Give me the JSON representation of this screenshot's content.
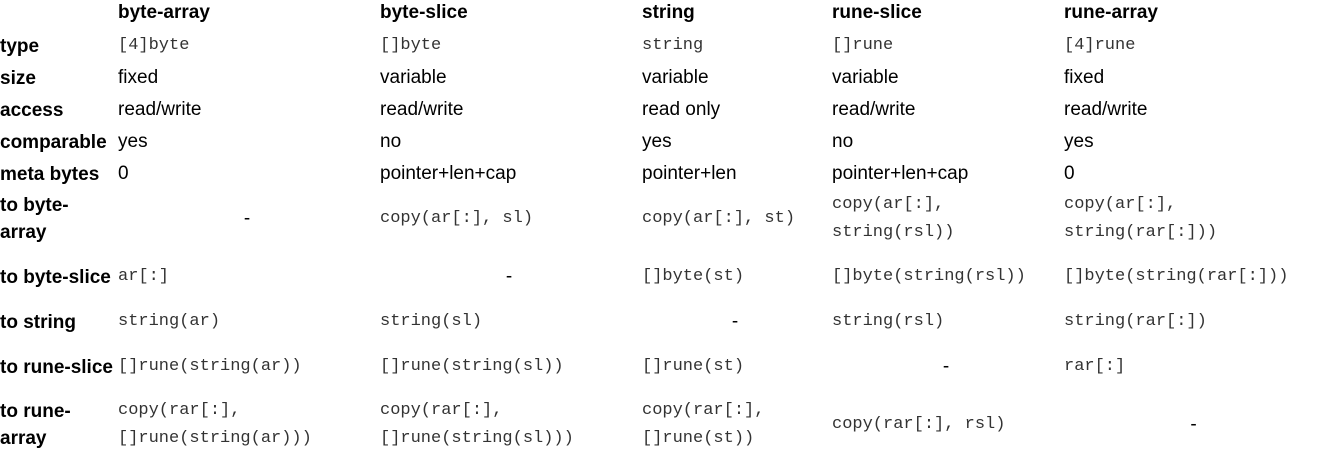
{
  "columns": [
    "",
    "byte-array",
    "byte-slice",
    "string",
    "rune-slice",
    "rune-array"
  ],
  "rows": [
    {
      "label": "type",
      "cells": [
        "[4]byte",
        "[]byte",
        "string",
        "[]rune",
        "[4]rune"
      ]
    },
    {
      "label": "size",
      "cells": [
        "fixed",
        "variable",
        "variable",
        "variable",
        "fixed"
      ]
    },
    {
      "label": "access",
      "cells": [
        "read/write",
        "read/write",
        "read only",
        "read/write",
        "read/write"
      ]
    },
    {
      "label": "comparable",
      "cells": [
        "yes",
        "no",
        "yes",
        "no",
        "yes"
      ]
    },
    {
      "label": "meta bytes",
      "cells": [
        "0",
        "pointer+len+cap",
        "pointer+len",
        "pointer+len+cap",
        "0"
      ]
    },
    {
      "label": "to byte-array",
      "cells": [
        "-",
        "copy(ar[:], sl)",
        "copy(ar[:], st)",
        "copy(ar[:], string(rsl))",
        "copy(ar[:], string(rar[:]))"
      ]
    },
    {
      "label": "to byte-slice",
      "cells": [
        "ar[:]",
        "-",
        "[]byte(st)",
        "[]byte(string(rsl))",
        "[]byte(string(rar[:]))"
      ]
    },
    {
      "label": "to string",
      "cells": [
        "string(ar)",
        "string(sl)",
        "-",
        "string(rsl)",
        "string(rar[:])"
      ]
    },
    {
      "label": "to rune-slice",
      "cells": [
        "[]rune(string(ar))",
        "[]rune(string(sl))",
        "[]rune(st)",
        "-",
        "rar[:]"
      ]
    },
    {
      "label": "to rune-array",
      "cells": [
        "copy(rar[:], []rune(string(ar)))",
        "copy(rar[:], []rune(string(sl)))",
        "copy(rar[:], []rune(st))",
        "copy(rar[:], rsl)",
        "-"
      ]
    }
  ]
}
